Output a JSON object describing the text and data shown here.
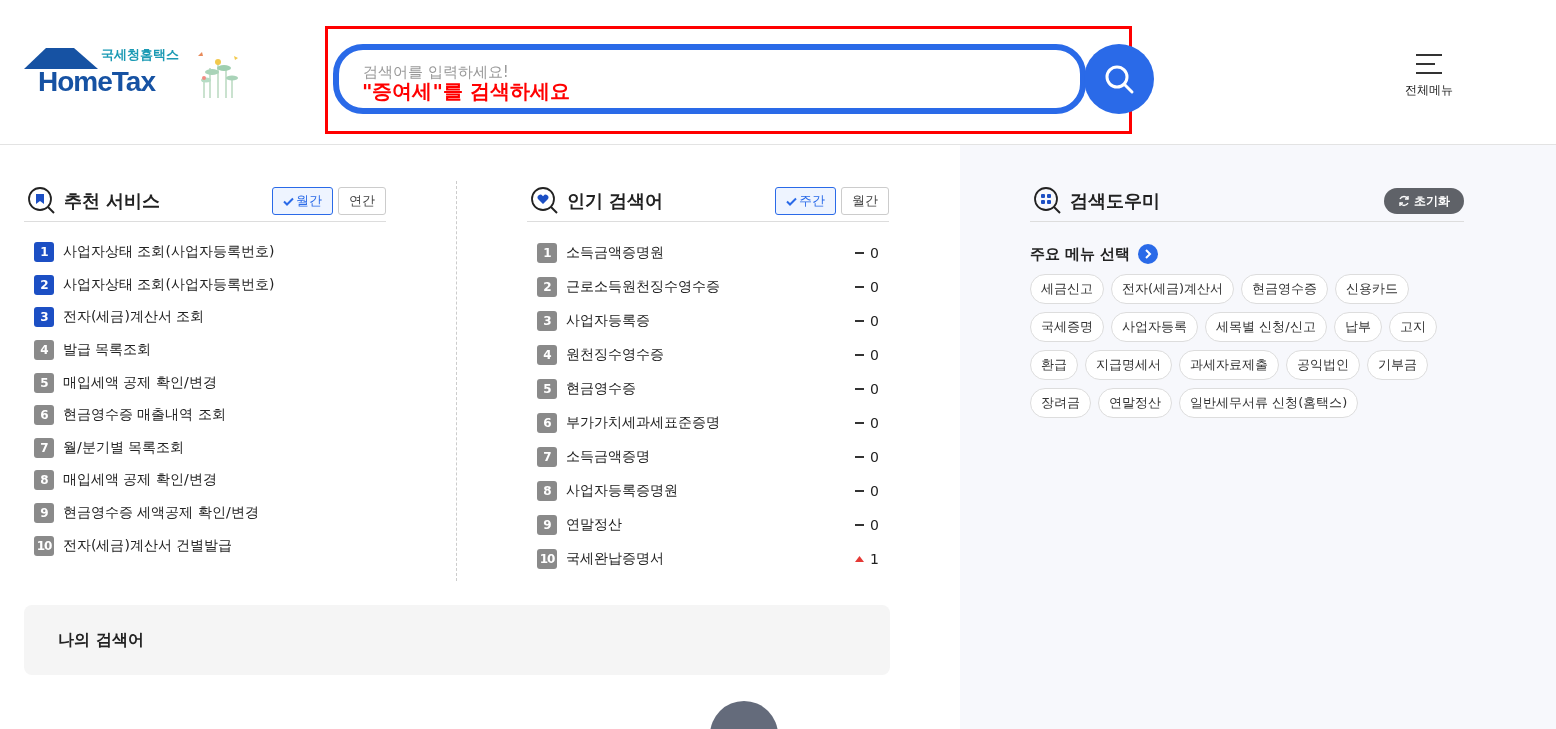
{
  "header": {
    "logo": {
      "subtitle": "국세청홈택스",
      "title": "HomeTax"
    },
    "search": {
      "placeholder": "검색어를 입력하세요!",
      "annotation": "\"증여세\"를 검색하세요"
    },
    "menu_button": {
      "label": "전체메뉴"
    }
  },
  "recommended": {
    "title": "추천 서비스",
    "toggles": [
      {
        "label": "월간",
        "selected": true
      },
      {
        "label": "연간",
        "selected": false
      }
    ],
    "items": [
      {
        "rank": "1",
        "label": "사업자상태 조회(사업자등록번호)",
        "top": true
      },
      {
        "rank": "2",
        "label": "사업자상태 조회(사업자등록번호)",
        "top": true
      },
      {
        "rank": "3",
        "label": "전자(세금)계산서 조회",
        "top": true
      },
      {
        "rank": "4",
        "label": "발급 목록조회",
        "top": false
      },
      {
        "rank": "5",
        "label": "매입세액 공제 확인/변경",
        "top": false
      },
      {
        "rank": "6",
        "label": "현금영수증 매출내역 조회",
        "top": false
      },
      {
        "rank": "7",
        "label": "월/분기별 목록조회",
        "top": false
      },
      {
        "rank": "8",
        "label": "매입세액 공제 확인/변경",
        "top": false
      },
      {
        "rank": "9",
        "label": "현금영수증 세액공제 확인/변경",
        "top": false
      },
      {
        "rank": "10",
        "label": "전자(세금)계산서 건별발급",
        "top": false
      }
    ]
  },
  "popular": {
    "title": "인기 검색어",
    "toggles": [
      {
        "label": "주간",
        "selected": true
      },
      {
        "label": "월간",
        "selected": false
      }
    ],
    "items": [
      {
        "rank": "1",
        "label": "소득금액증명원",
        "kind": "same",
        "change": "0"
      },
      {
        "rank": "2",
        "label": "근로소득원천징수영수증",
        "kind": "same",
        "change": "0"
      },
      {
        "rank": "3",
        "label": "사업자등록증",
        "kind": "same",
        "change": "0"
      },
      {
        "rank": "4",
        "label": "원천징수영수증",
        "kind": "same",
        "change": "0"
      },
      {
        "rank": "5",
        "label": "현금영수증",
        "kind": "same",
        "change": "0"
      },
      {
        "rank": "6",
        "label": "부가가치세과세표준증명",
        "kind": "same",
        "change": "0"
      },
      {
        "rank": "7",
        "label": "소득금액증명",
        "kind": "same",
        "change": "0"
      },
      {
        "rank": "8",
        "label": "사업자등록증명원",
        "kind": "same",
        "change": "0"
      },
      {
        "rank": "9",
        "label": "연말정산",
        "kind": "same",
        "change": "0"
      },
      {
        "rank": "10",
        "label": "국세완납증명서",
        "kind": "up",
        "change": "1"
      }
    ]
  },
  "my_searches": {
    "title": "나의 검색어"
  },
  "helper": {
    "title": "검색도우미",
    "reset_button": "초기화",
    "section_title": "주요 메뉴 선택",
    "chips": [
      "세금신고",
      "전자(세금)계산서",
      "현금영수증",
      "신용카드",
      "국세증명",
      "사업자등록",
      "세목별 신청/신고",
      "납부",
      "고지",
      "환급",
      "지급명세서",
      "과세자료제출",
      "공익법인",
      "기부금",
      "장려금",
      "연말정산",
      "일반세무서류 신청(홈택스)"
    ]
  }
}
